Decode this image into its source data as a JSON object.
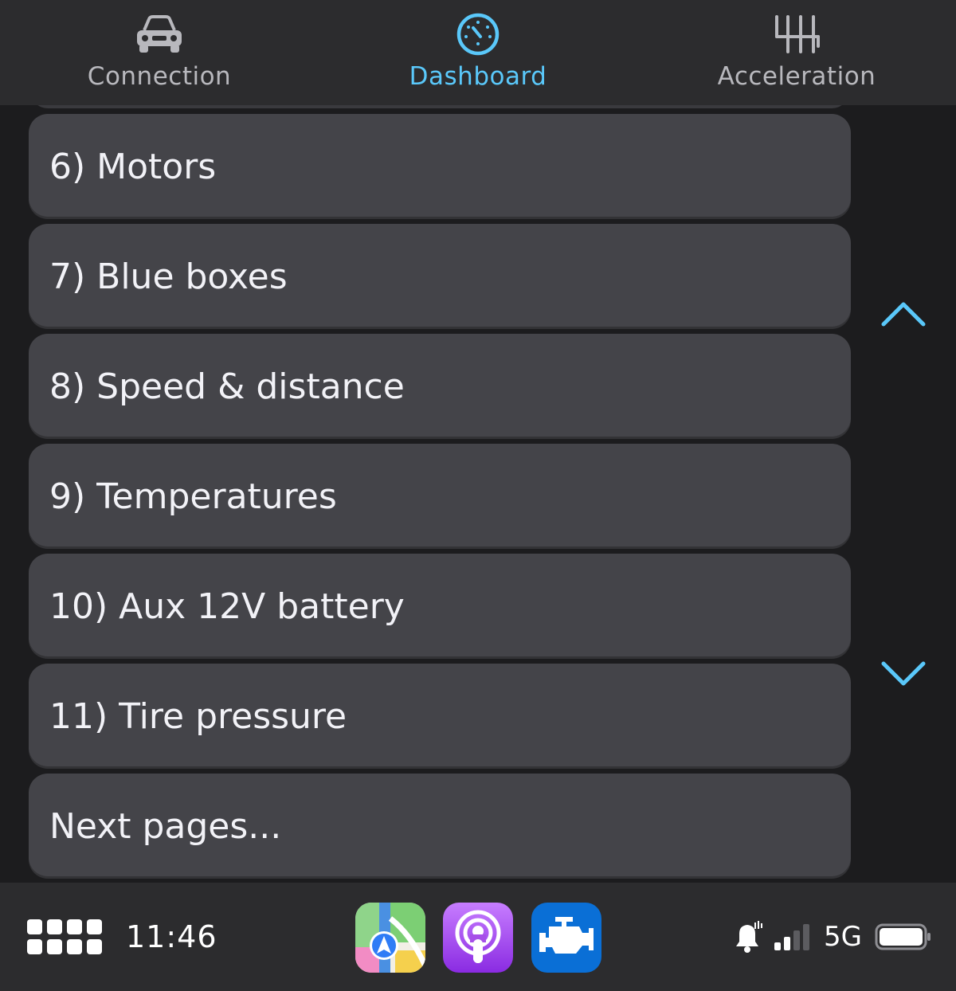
{
  "tabs": [
    {
      "id": "connection",
      "label": "Connection",
      "icon": "car-icon",
      "active": false
    },
    {
      "id": "dashboard",
      "label": "Dashboard",
      "icon": "speedometer-icon",
      "active": true
    },
    {
      "id": "acceleration",
      "label": "Acceleration",
      "icon": "gear-shift-icon",
      "active": false
    }
  ],
  "list": {
    "items": [
      "6) Motors",
      "7) Blue boxes",
      "8) Speed & distance",
      "9) Temperatures",
      "10) Aux 12V battery",
      "11) Tire pressure",
      "Next pages..."
    ]
  },
  "scroll": {
    "up_icon": "chevron-up-icon",
    "down_icon": "chevron-down-icon"
  },
  "dock": {
    "time": "11:46",
    "apps": [
      "maps-app-icon",
      "podcasts-app-icon",
      "obd-engine-app-icon"
    ],
    "network": "5G"
  },
  "colors": {
    "accent": "#5ac8fa",
    "row_bg": "#444449",
    "bar_bg": "#2c2c2e",
    "page_bg": "#1c1c1e"
  }
}
